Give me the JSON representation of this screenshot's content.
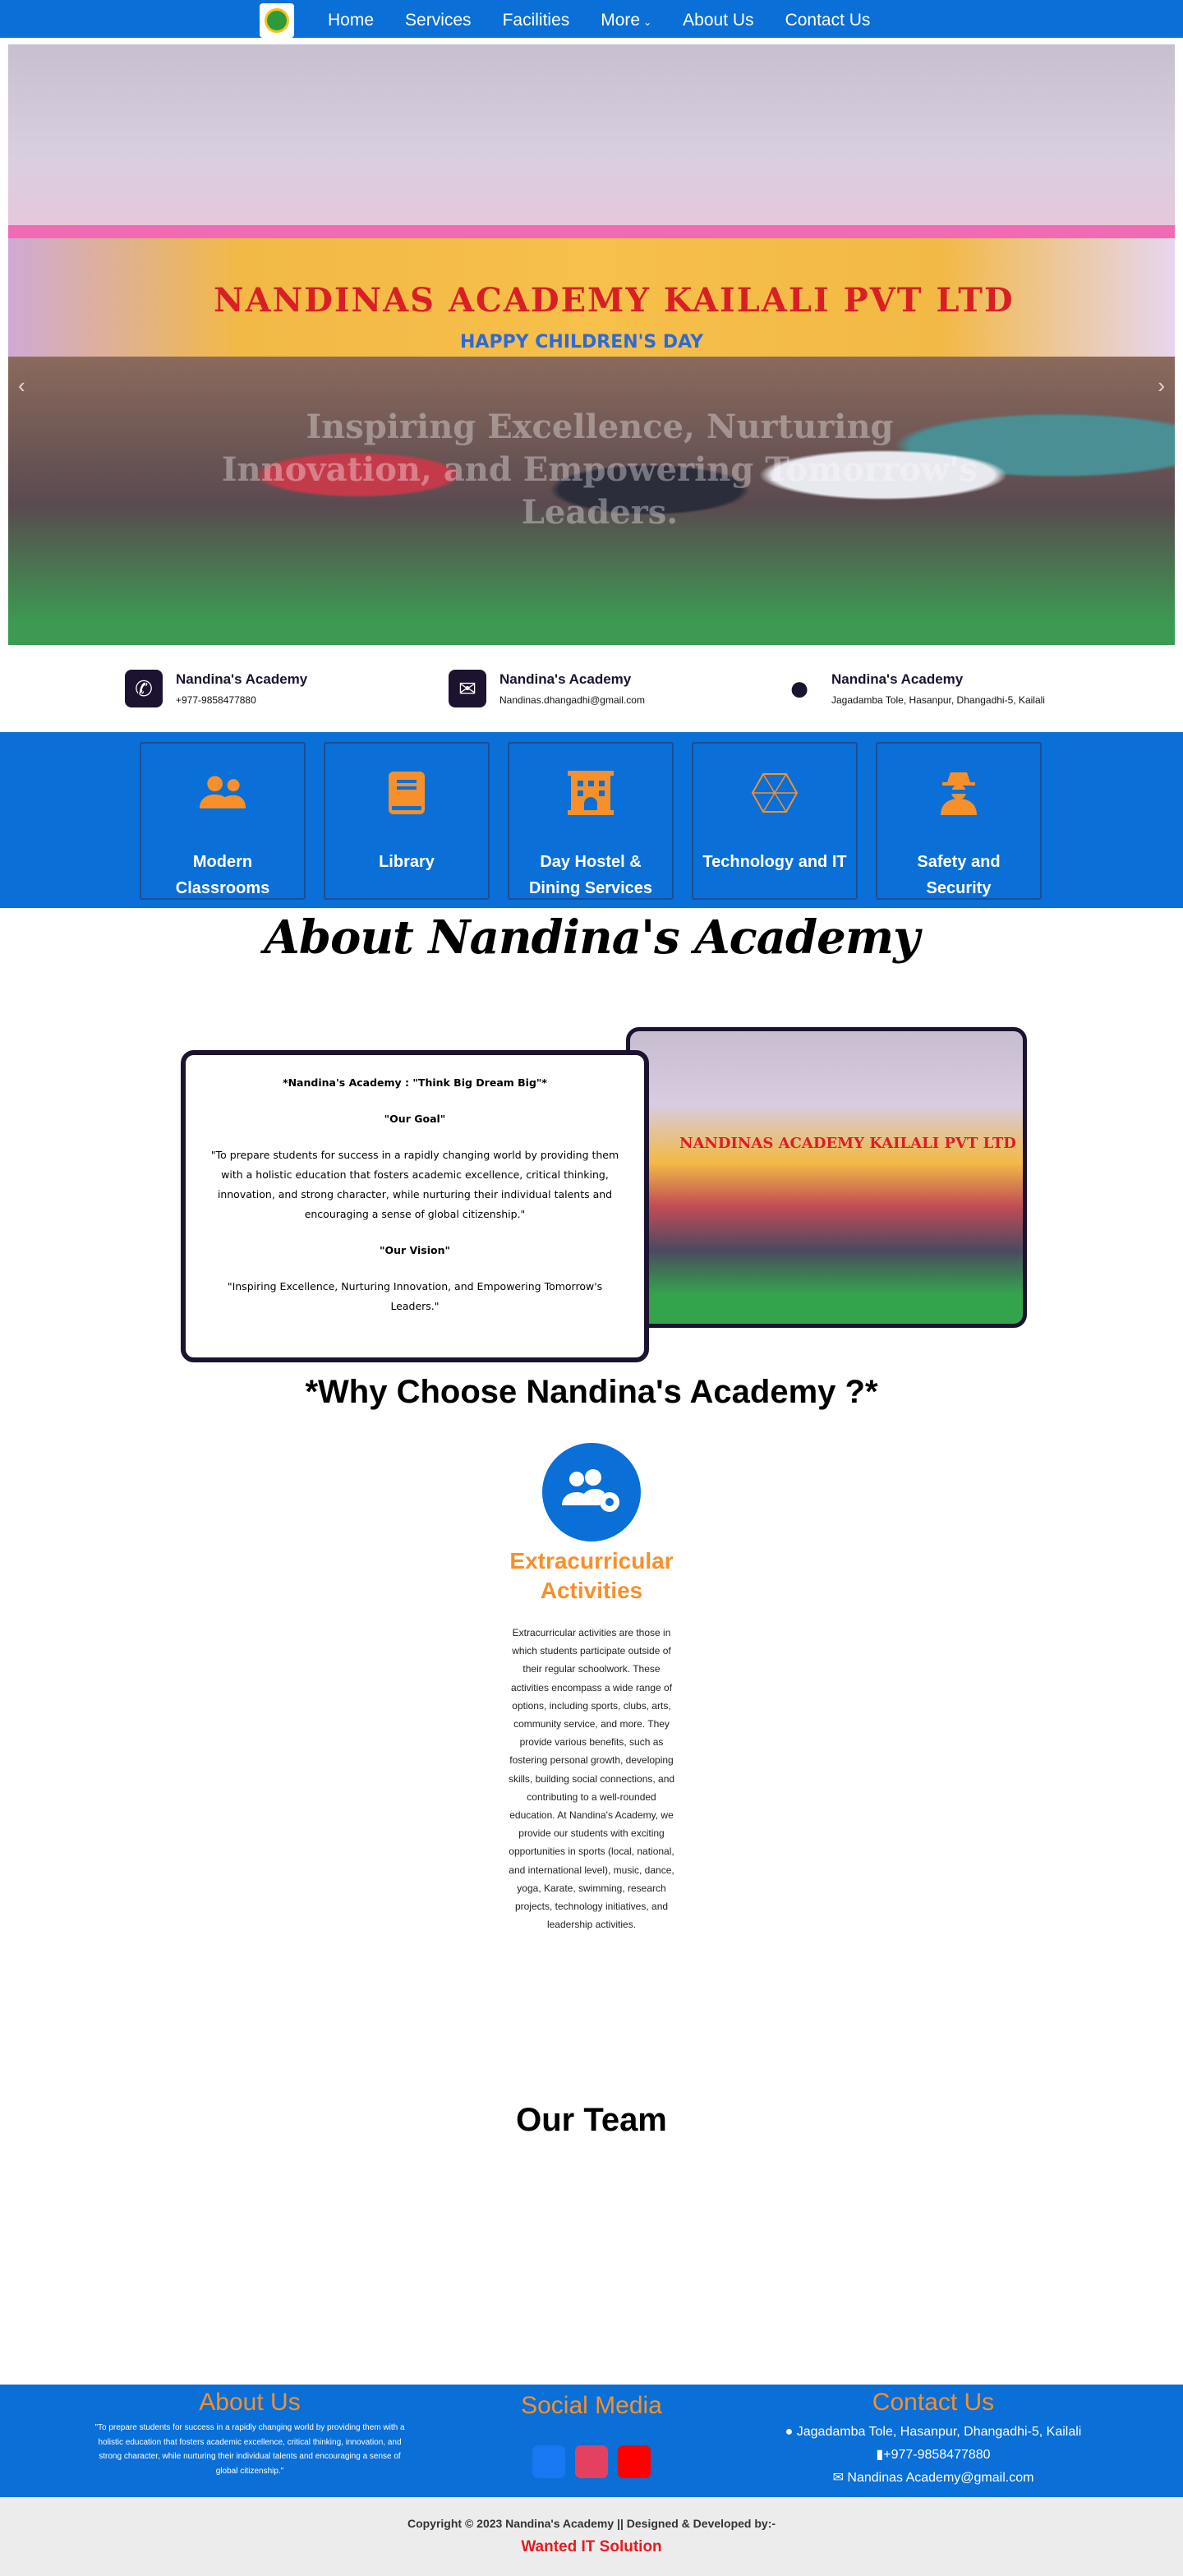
{
  "nav": {
    "logo_alt": "logo",
    "items": [
      "Home",
      "Services",
      "Facilities",
      "More",
      "About Us",
      "Contact Us"
    ]
  },
  "hero": {
    "banner": "NANDINAS ACADEMY KAILALI PVT LTD",
    "sub_banner": "HAPPY CHILDREN'S DAY",
    "caption": "Inspiring Excellence, Nurturing Innovation, and Empowering Tomorrow's Leaders."
  },
  "info": [
    {
      "title": "Nandina's Academy",
      "sub": "+977-9858477880",
      "icon": "phone-icon"
    },
    {
      "title": "Nandina's Academy",
      "sub": "Nandinas.dhangadhi@gmail.com",
      "icon": "envelope-icon"
    },
    {
      "title": "Nandina's Academy",
      "sub": "Jagadamba Tole, Hasanpur, Dhangadhi-5, Kailali",
      "icon": "map-pin-icon"
    }
  ],
  "features": [
    {
      "label": "Modern Classrooms",
      "icon": "users-icon"
    },
    {
      "label": "Library",
      "icon": "book-icon"
    },
    {
      "label": "Day Hostel & Dining Services",
      "icon": "building-icon"
    },
    {
      "label": "Technology and IT",
      "icon": "hexagon-network-icon"
    },
    {
      "label": "Safety and Security",
      "icon": "user-secret-icon"
    }
  ],
  "about": {
    "title": "About Nandina's Academy",
    "tagline": "*Nandina's Academy : \"Think Big Dream Big\"*",
    "goal_head": "\"Our Goal\"",
    "goal_text": "\"To prepare students for success in a rapidly changing world by providing them with a holistic education that fosters academic excellence, critical thinking, innovation, and strong character, while nurturing their individual talents and encouraging a sense of global citizenship.\"",
    "vision_head": "\"Our Vision\"",
    "vision_text": "\"Inspiring Excellence, Nurturing Innovation, and Empowering Tomorrow's Leaders.\"",
    "photo_banner": "NANDINAS ACADEMY KAILALI PVT LTD"
  },
  "why": {
    "title": "*Why Choose Nandina's Academy ?*",
    "head": "Extracurricular Activities",
    "text": "Extracurricular activities are those in which students participate outside of their regular schoolwork. These activities encompass a wide range of options, including sports, clubs, arts, community service, and more. They provide various benefits, such as fostering personal growth, developing skills, building social connections, and contributing to a well-rounded education. At Nandina's Academy, we provide our students with exciting opportunities in sports (local, national, and international level), music, dance, yoga, Karate, swimming, research projects, technology initiatives, and leadership activities."
  },
  "team": {
    "title": "Our Team"
  },
  "footer": {
    "about_head": "About Us",
    "about_text": "\"To prepare students for success in a rapidly changing world by providing them with a holistic education that fosters academic excellence, critical thinking, innovation, and strong character, while nurturing their individual talents and encouraging a sense of global citizenship.\"",
    "social_head": "Social Media",
    "social": [
      {
        "name": "facebook-icon",
        "color": "#1877f2"
      },
      {
        "name": "instagram-icon",
        "color": "#e4405f"
      },
      {
        "name": "youtube-icon",
        "color": "#ff0000"
      }
    ],
    "contact_head": "Contact Us",
    "address": "Jagadamba Tole, Hasanpur, Dhangadhi-5, Kailali",
    "phone": "+977-9858477880",
    "email": "Nandinas Academy@gmail.com"
  },
  "copyright": {
    "line": "Copyright © 2023 Nandina's Academy || Designed & Developed by:-",
    "developer": "Wanted IT Solution"
  },
  "colors": {
    "primary": "#0a6fd6",
    "accent": "#f7902a",
    "dark": "#1c1330",
    "developer": "#e31b23"
  }
}
